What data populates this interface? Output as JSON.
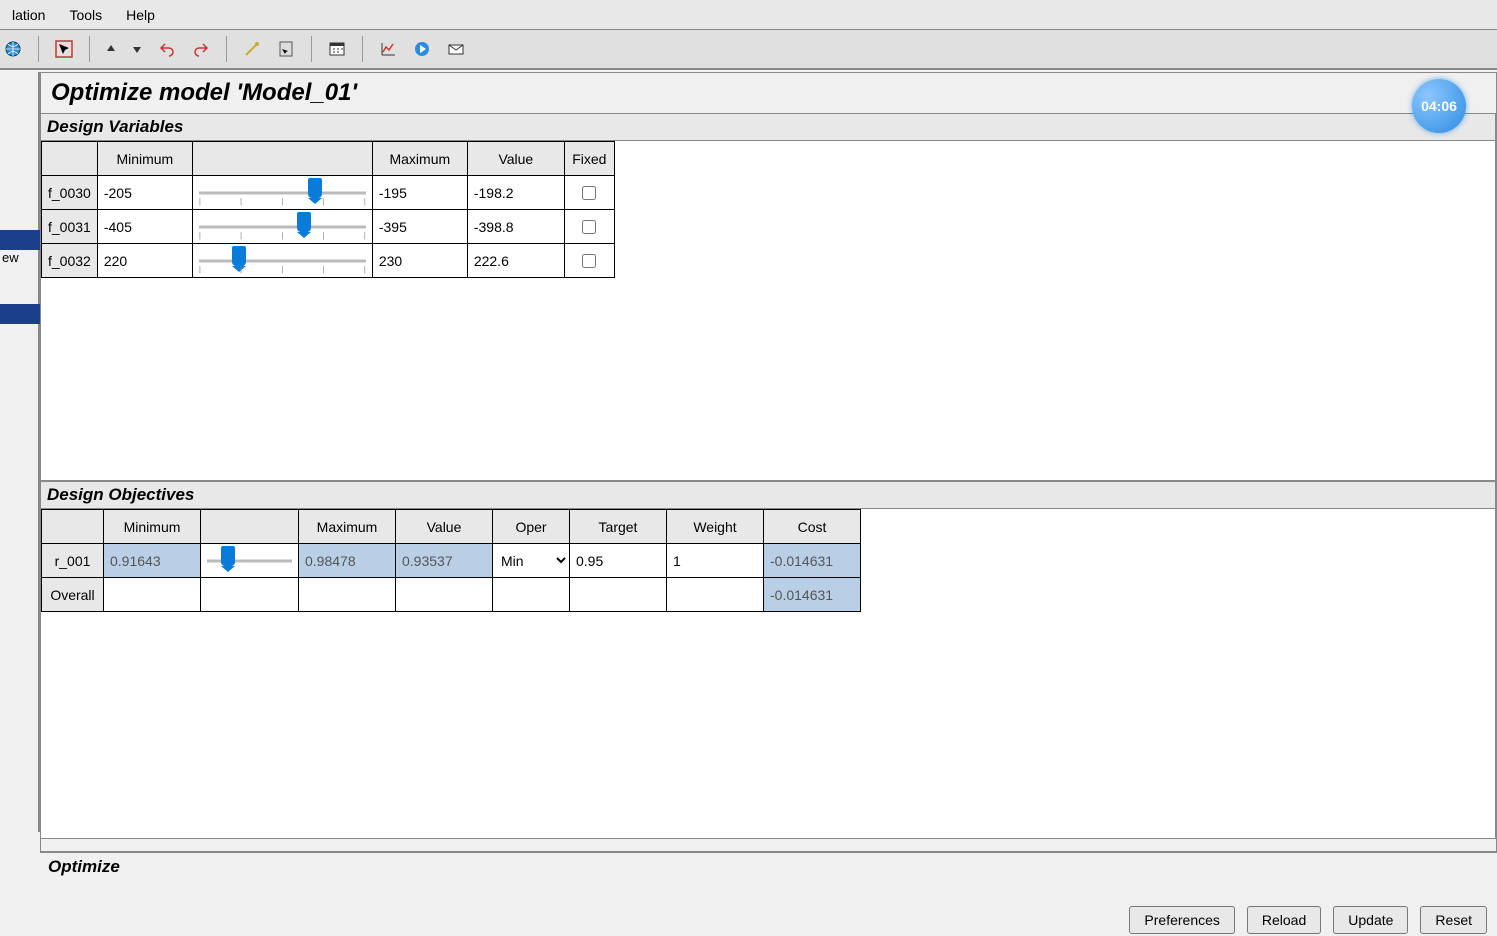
{
  "menubar": [
    "lation",
    "Tools",
    "Help"
  ],
  "left_panel": {
    "sel_text": "",
    "ew_text": "ew"
  },
  "title": "Optimize model 'Model_01'",
  "timer": "04:06",
  "design_variables": {
    "label": "Design Variables",
    "headers": [
      "",
      "Minimum",
      "",
      "Maximum",
      "Value",
      "Fixed"
    ],
    "rows": [
      {
        "name": "f_0030",
        "min": "-205",
        "slider_pct": 68,
        "max": "-195",
        "value": "-198.2",
        "fixed": false
      },
      {
        "name": "f_0031",
        "min": "-405",
        "slider_pct": 62,
        "max": "-395",
        "value": "-398.8",
        "fixed": false
      },
      {
        "name": "f_0032",
        "min": "220",
        "slider_pct": 26,
        "max": "230",
        "value": "222.6",
        "fixed": false
      }
    ]
  },
  "design_objectives": {
    "label": "Design Objectives",
    "headers": [
      "",
      "Minimum",
      "",
      "Maximum",
      "Value",
      "Oper",
      "Target",
      "Weight",
      "Cost"
    ],
    "rows": [
      {
        "name": "r_001",
        "min": "0.91643",
        "slider_pct": 28,
        "max": "0.98478",
        "value": "0.93537",
        "oper": "Min",
        "target": "0.95",
        "weight": "1",
        "cost": "-0.014631"
      }
    ],
    "overall_label": "Overall",
    "overall_cost": "-0.014631"
  },
  "footer": {
    "label": "Optimize",
    "buttons": [
      "Preferences",
      "Reload",
      "Update",
      "Reset"
    ]
  }
}
